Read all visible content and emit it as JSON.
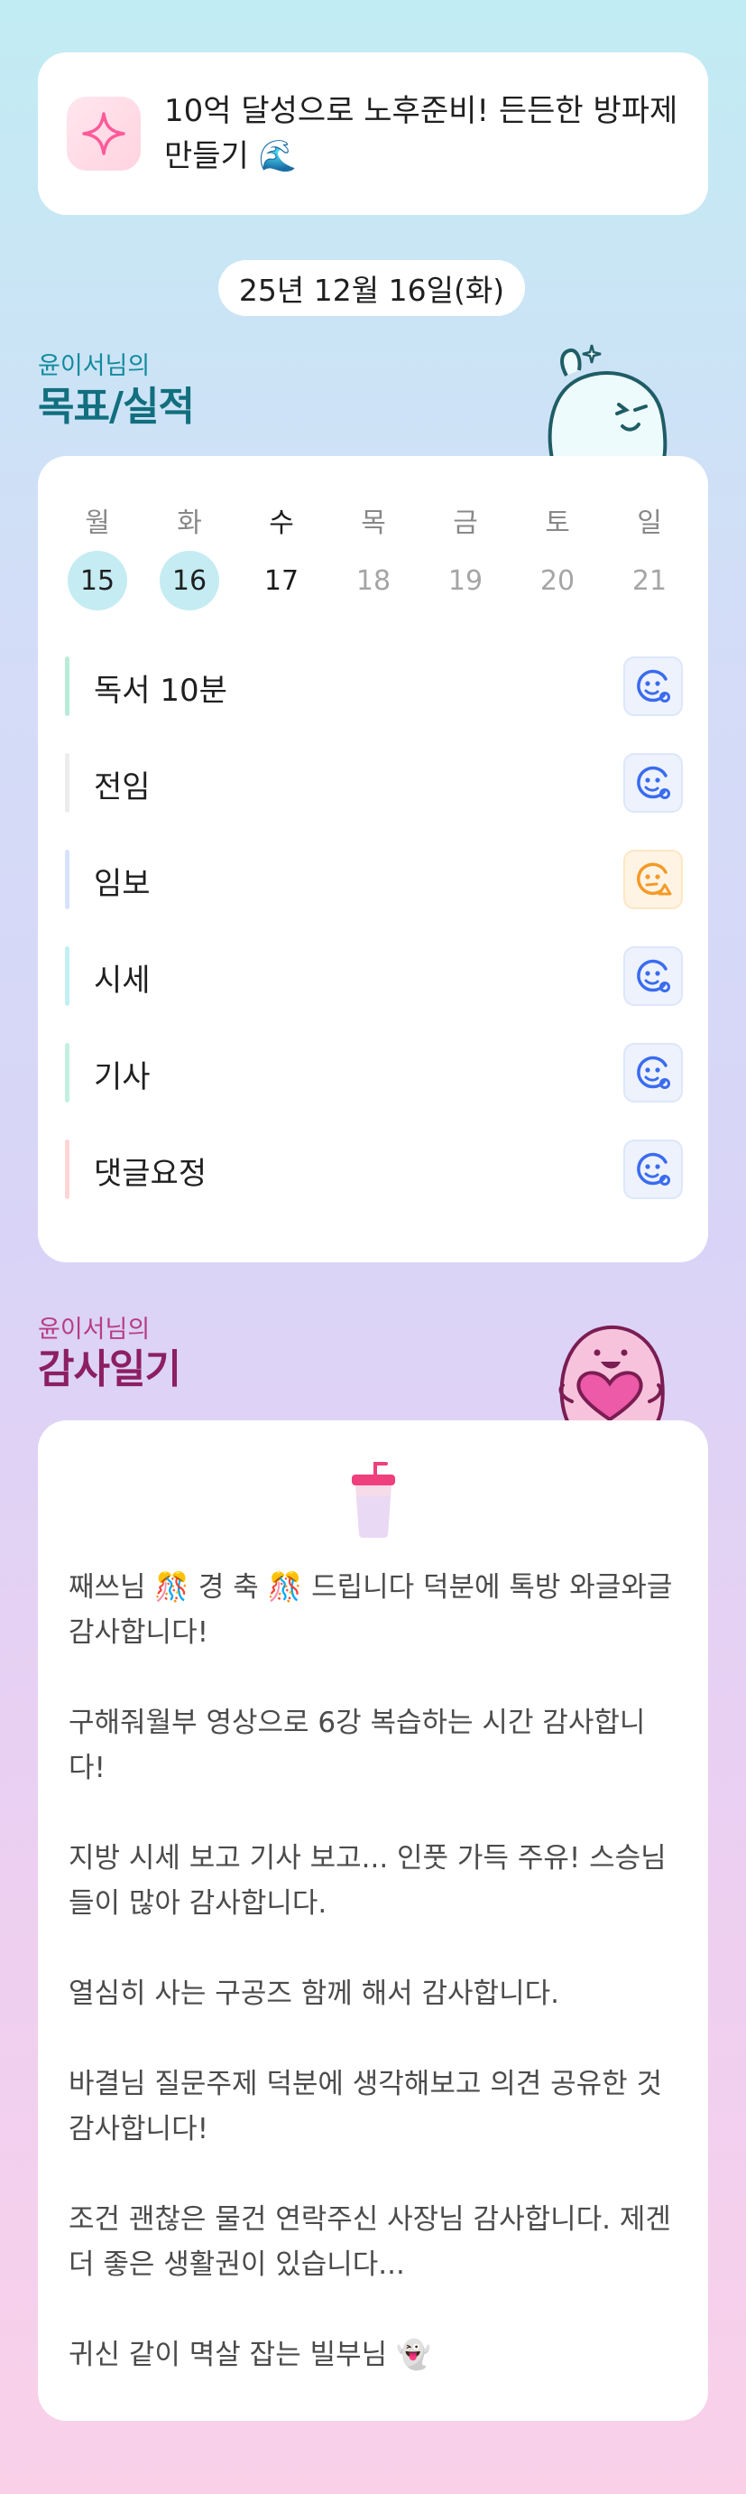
{
  "goal": {
    "icon": "sparkle-icon",
    "line1": "10억 달성으로 노후준비! 든든한 방파제",
    "line2": "만들기 🌊"
  },
  "date": "25년 12월 16일(화)",
  "goals_section": {
    "subtitle": "윤이서님의",
    "title": "목표/실적",
    "mascot": "waving-mascot-icon"
  },
  "week": {
    "days": [
      {
        "label": "월",
        "num": "15",
        "state": "done"
      },
      {
        "label": "화",
        "num": "16",
        "state": "done"
      },
      {
        "label": "수",
        "num": "17",
        "state": "today"
      },
      {
        "label": "목",
        "num": "18",
        "state": "future"
      },
      {
        "label": "금",
        "num": "19",
        "state": "future"
      },
      {
        "label": "토",
        "num": "20",
        "state": "future"
      },
      {
        "label": "일",
        "num": "21",
        "state": "future"
      }
    ]
  },
  "tasks": [
    {
      "label": "독서 10분",
      "bar_color": "#b9ecd8",
      "status": "smile-icon"
    },
    {
      "label": "전임",
      "bar_color": "#ececec",
      "status": "smile-icon"
    },
    {
      "label": "임보",
      "bar_color": "#d7e2fb",
      "status": "meh-warning-icon"
    },
    {
      "label": "시세",
      "bar_color": "#c2eff2",
      "status": "smile-icon"
    },
    {
      "label": "기사",
      "bar_color": "#c2f0e0",
      "status": "smile-icon"
    },
    {
      "label": "댓글요정",
      "bar_color": "#ffd4d4",
      "status": "smile-icon"
    }
  ],
  "diary_section": {
    "subtitle": "윤이서님의",
    "title": "감사일기",
    "mascot": "heart-mascot-icon"
  },
  "diary": {
    "icon": "drink-cup-icon",
    "entries": [
      "째쓰님 🎊 경 축 🎊 드립니다 덕분에 톡방 와글와글 감사합니다!",
      "구해줘월부 영상으로 6강 복습하는 시간 감사합니다!",
      "지방 시세 보고 기사 보고... 인풋 가득 주유! 스승님들이 많아 감사합니다.",
      "열심히 사는 구공즈 함께 해서 감사합니다.",
      "바결님 질문주제 덕분에 생각해보고 의견 공유한 것 감사합니다!",
      "조건 괜찮은 물건 연락주신 사장님 감사합니다. 제겐 더 좋은 생활권이 있습니다...",
      "귀신 같이 멱살 잡는 빌부님 👻"
    ]
  },
  "colors": {
    "accent_teal": "#116f7e",
    "accent_pink": "#8c1f62",
    "done_circle": "#c4ecf2",
    "status_blue": "#3a6bf0",
    "status_orange": "#f49a28"
  }
}
